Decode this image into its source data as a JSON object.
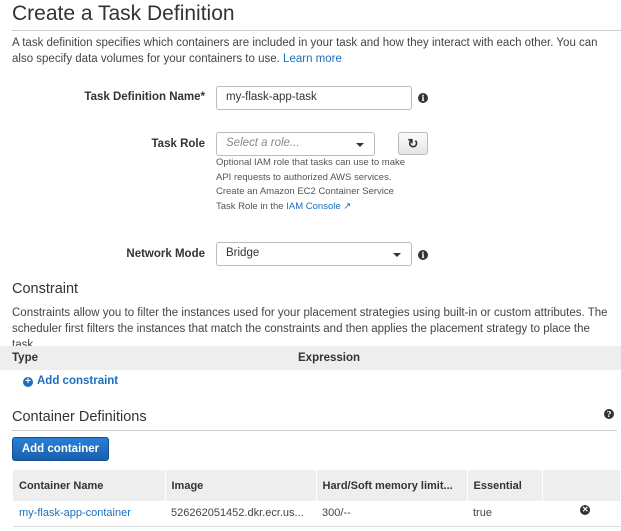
{
  "page": {
    "title": "Create a Task Definition",
    "description": "A task definition specifies which containers are included in your task and how they interact with each other. You can also specify data volumes for your containers to use.",
    "learn_more": "Learn more"
  },
  "form": {
    "task_name": {
      "label": "Task Definition Name*",
      "value": "my-flask-app-task"
    },
    "task_role": {
      "label": "Task Role",
      "placeholder": "Select a role...",
      "help": "Optional IAM role that tasks can use to make API requests to authorized AWS services. Create an Amazon EC2 Container Service Task Role in the",
      "help_link": "IAM Console"
    },
    "network_mode": {
      "label": "Network Mode",
      "value": "Bridge"
    }
  },
  "constraint": {
    "title": "Constraint",
    "description": "Constraints allow you to filter the instances used for your placement strategies using built-in or custom attributes. The scheduler first filters the instances that match the constraints and then applies the placement strategy to place the task.",
    "columns": [
      "Type",
      "Expression"
    ],
    "add_label": "Add constraint"
  },
  "containers": {
    "title": "Container Definitions",
    "add_button": "Add container",
    "columns": [
      "Container Name",
      "Image",
      "Hard/Soft memory limit...",
      "Essential",
      ""
    ],
    "rows": [
      {
        "name": "my-flask-app-container",
        "image": "526262051452.dkr.ecr.us...",
        "memory": "300/--",
        "essential": "true"
      }
    ]
  },
  "colors": {
    "link": "#1a6fc0",
    "primary_button": "#1f6ec2"
  }
}
